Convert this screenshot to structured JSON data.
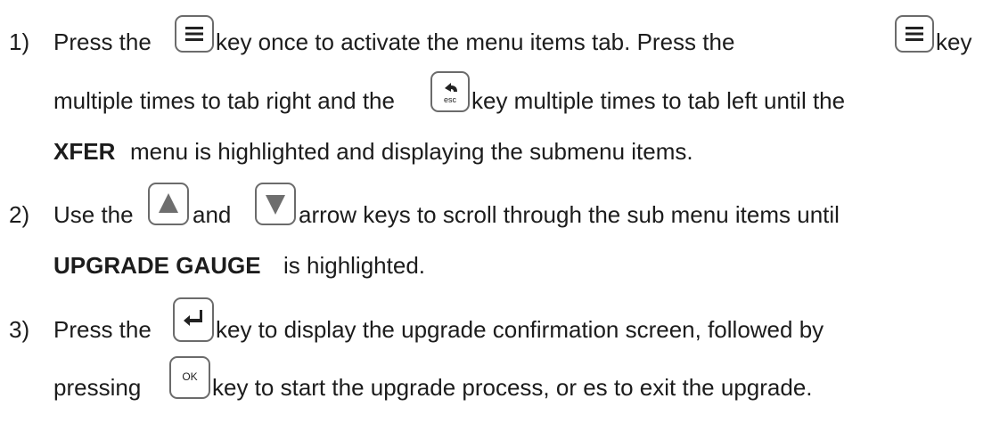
{
  "steps": [
    {
      "number": "1)",
      "line1": {
        "seg1": "Press the",
        "seg2": "key once to activate the menu items tab.  Press the",
        "seg3": "key"
      },
      "line2": {
        "seg1": "multiple times to tab right and the",
        "seg2": "key multiple times to tab left until the"
      },
      "line3": {
        "bold": "XFER",
        "rest": "menu is highlighted and displaying the submenu items."
      }
    },
    {
      "number": "2)",
      "line1": {
        "seg1": "Use the",
        "seg2": "and",
        "seg3": "arrow keys to scroll through the sub menu items until"
      },
      "line2": {
        "bold": "UPGRADE GAUGE",
        "rest": "is highlighted."
      }
    },
    {
      "number": "3)",
      "line1": {
        "seg1": "Press the",
        "seg2": "key to display the upgrade confirmation screen, followed by"
      },
      "line2": {
        "seg1": "pressing",
        "seg2": "key to start the upgrade process, or es to exit the upgrade."
      }
    }
  ],
  "keys": {
    "esc_label": "esc",
    "ok_label": "OK"
  },
  "icons": {
    "menu": "menu-icon",
    "esc": "back-arrow-icon",
    "up": "up-arrow-icon",
    "down": "down-arrow-icon",
    "enter": "enter-icon"
  }
}
